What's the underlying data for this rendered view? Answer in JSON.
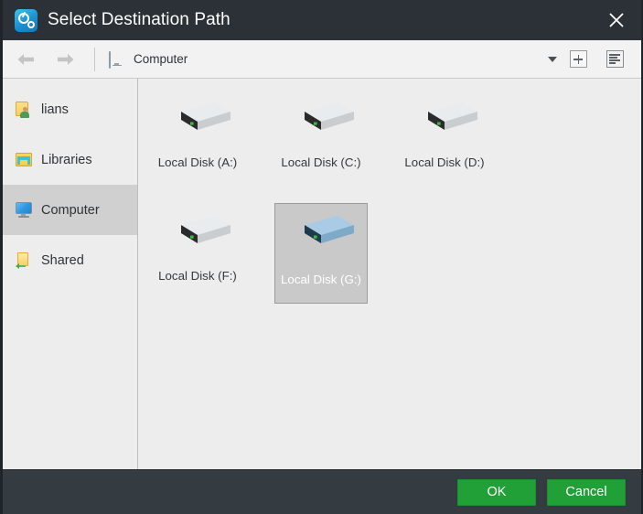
{
  "window": {
    "title": "Select Destination Path",
    "app_icon": "settings-gear-icon",
    "close_icon": "close-icon",
    "accent_color": "#22a038",
    "chrome_color": "#2b3136",
    "footer_color": "#353c41"
  },
  "toolbar": {
    "back_icon": "arrow-left-icon",
    "forward_icon": "arrow-right-icon",
    "path_icon": "monitor-icon",
    "path_label": "Computer",
    "dropdown_icon": "chevron-down-icon",
    "new_folder_icon": "plus-icon",
    "view_icon": "list-view-icon"
  },
  "sidebar": {
    "items": [
      {
        "label": "lians",
        "icon": "user-folder-icon",
        "selected": false
      },
      {
        "label": "Libraries",
        "icon": "libraries-folder-icon",
        "selected": false
      },
      {
        "label": "Computer",
        "icon": "computer-monitor-icon",
        "selected": true
      },
      {
        "label": "Shared",
        "icon": "shared-folder-icon",
        "selected": false
      }
    ]
  },
  "content": {
    "drives": [
      {
        "label": "Local Disk (A:)",
        "icon": "hard-disk-icon",
        "selected": false
      },
      {
        "label": "Local Disk (C:)",
        "icon": "hard-disk-icon",
        "selected": false
      },
      {
        "label": "Local Disk (D:)",
        "icon": "hard-disk-icon",
        "selected": false
      },
      {
        "label": "Local Disk (F:)",
        "icon": "hard-disk-icon",
        "selected": false
      },
      {
        "label": "Local Disk (G:)",
        "icon": "hard-disk-icon",
        "selected": true
      }
    ]
  },
  "footer": {
    "ok_label": "OK",
    "cancel_label": "Cancel"
  }
}
